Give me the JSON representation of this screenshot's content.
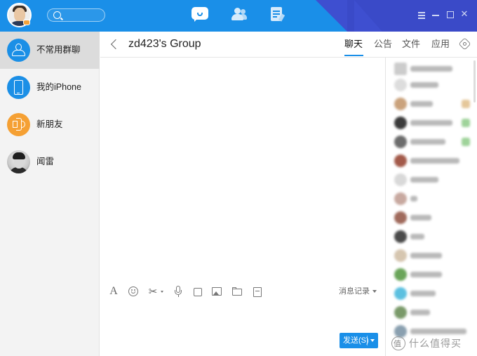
{
  "titlebar": {
    "window_controls": [
      "menu-icon",
      "minimize-icon",
      "maximize-icon",
      "close-icon"
    ],
    "close_glyph": "✕",
    "nav": [
      "chat-icon",
      "contacts-icon",
      "docs-icon"
    ]
  },
  "sidebar": {
    "items": [
      {
        "label": "不常用群聊",
        "icon": "group-icon",
        "active": true
      },
      {
        "label": "我的iPhone",
        "icon": "phone-icon",
        "active": false
      },
      {
        "label": "新朋友",
        "icon": "speaker-icon",
        "active": false
      },
      {
        "label": "闻雷",
        "icon": "avatar",
        "active": false
      }
    ]
  },
  "header": {
    "title": "zd423's Group",
    "tabs": [
      {
        "label": "聊天",
        "active": true
      },
      {
        "label": "公告",
        "active": false
      },
      {
        "label": "文件",
        "active": false
      },
      {
        "label": "应用",
        "active": false
      }
    ]
  },
  "toolbar": {
    "font_glyph": "A",
    "history_label": "消息记录"
  },
  "input": {
    "send_label": "发送(S)"
  },
  "watermark": {
    "text": "什么值得买"
  },
  "colors": {
    "titlebar": "#1a8fe8",
    "accent": "#1a8fe8",
    "friend_icon": "#f5a033"
  }
}
